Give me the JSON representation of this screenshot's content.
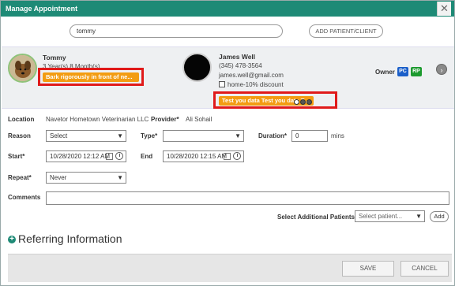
{
  "window": {
    "title": "Manage Appointment",
    "close_symbol": "✕"
  },
  "search": {
    "value": "tommy",
    "placeholder": ""
  },
  "add_patient_button": "ADD PATIENT/CLIENT",
  "patient": {
    "name": "Tommy",
    "age": "3 Year(s) 8 Month(s)",
    "alert": "Bark rigorously in front of ne..."
  },
  "client": {
    "name": "James Well",
    "phone": "(345) 478-3564",
    "email": "james.well@gmail.com",
    "discount_label": "home-10% discount",
    "discount_checked": false,
    "alert": "Test you data Test you data T..."
  },
  "owner": {
    "label": "Owner",
    "badges": [
      "PC",
      "RP"
    ],
    "badge_colors": [
      "#1b5fc9",
      "#1c9a2f"
    ]
  },
  "form": {
    "location_label": "Location",
    "location_value": "Navetor Hometown Veterinarian LLC",
    "provider_label": "Provider*",
    "provider_value": "Ali Sohail",
    "reason_label": "Reason",
    "reason_value": "Select",
    "type_label": "Type*",
    "type_value": "",
    "duration_label": "Duration*",
    "duration_value": "0",
    "duration_unit": "mins",
    "start_label": "Start*",
    "start_value": "10/28/2020 12:12 AM",
    "end_label": "End",
    "end_value": "10/28/2020 12:15 AM",
    "repeat_label": "Repeat*",
    "repeat_value": "Never",
    "comments_label": "Comments",
    "comments_value": "",
    "additional_patients_label": "Select Additional Patients",
    "additional_patients_placeholder": "Select patient...",
    "add_label": "Add"
  },
  "referring": {
    "title": "Referring Information",
    "toggle_symbol": "+"
  },
  "footer": {
    "save_label": "SAVE",
    "cancel_label": "CANCEL"
  },
  "colors": {
    "title_bar": "#1e8a76",
    "alert": "#f39c12",
    "highlight": "#e01a1a"
  }
}
